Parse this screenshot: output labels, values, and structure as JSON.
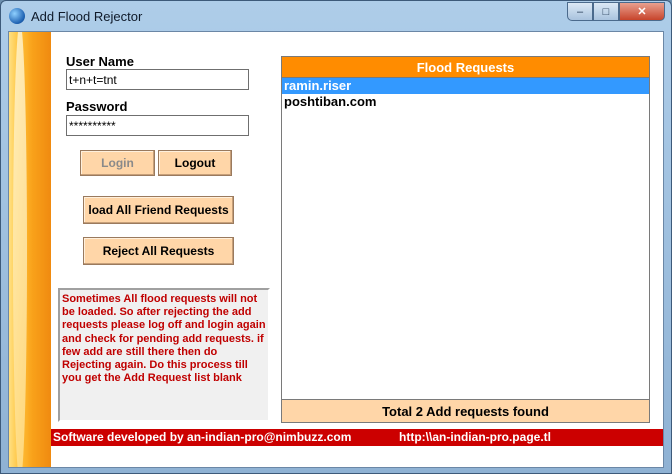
{
  "window": {
    "title": "Add Flood Rejector",
    "minimize_glyph": "–",
    "maximize_glyph": "□",
    "close_glyph": "✕"
  },
  "login": {
    "username_label": "User Name",
    "username_value": "t+n+t=tnt",
    "password_label": "Password",
    "password_value": "**********",
    "login_button": "Login",
    "logout_button": "Logout"
  },
  "actions": {
    "load_button": "load All Friend Requests",
    "reject_button": "Reject All  Requests"
  },
  "note": "Sometimes All flood requests will not be loaded. So after rejecting the add requests please log off and login again and check for pending add requests. if few add are still there then do Rejecting again. Do this process till you get the Add Request list blank",
  "requests": {
    "header": "Flood Requests",
    "items": [
      "ramin.riser",
      "poshtiban.com"
    ],
    "selected_index": 0,
    "footer": "Total 2 Add requests found"
  },
  "status_bar": {
    "developer": "Software developed by an-indian-pro@nimbuzz.com",
    "url": "http:\\\\an-indian-pro.page.tl"
  },
  "colors": {
    "accent_orange": "#ff8c00",
    "button_peach": "#ffd6a8",
    "selection_blue": "#3399ff",
    "status_red": "#cc0000",
    "note_text_red": "#c00000"
  }
}
